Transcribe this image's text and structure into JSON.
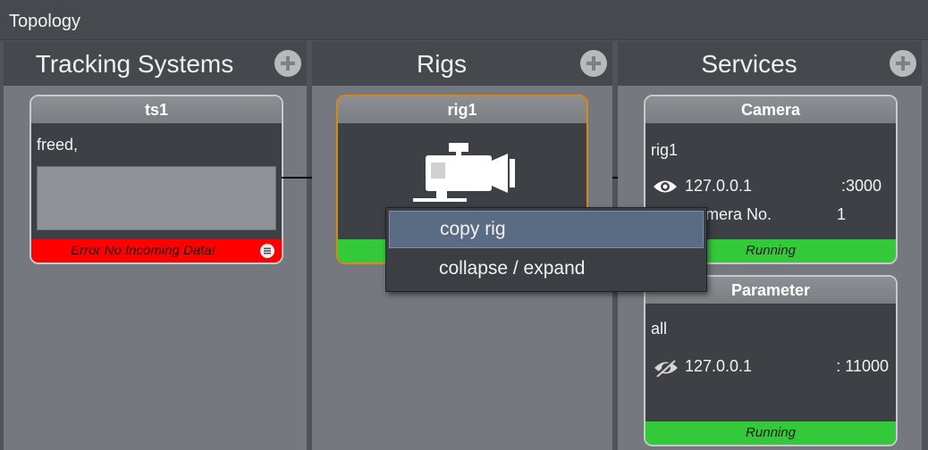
{
  "window": {
    "title": "Topology"
  },
  "columns": [
    {
      "label": "Tracking Systems"
    },
    {
      "label": "Rigs"
    },
    {
      "label": "Services"
    }
  ],
  "tracking_system": {
    "name": "ts1",
    "text": "freed,",
    "status": "Error No Incoming Data!",
    "status_color": "#ff0000"
  },
  "rig": {
    "name": "rig1",
    "icon": "camera-icon",
    "status_color": "#34c93a",
    "border_color": "#d48a1a"
  },
  "services": {
    "camera": {
      "title": "Camera",
      "rig": "rig1",
      "ip": "127.0.0.1",
      "port": ":3000",
      "camera_label": "Camera No.",
      "camera_no": "1",
      "status": "Running"
    },
    "parameter": {
      "title": "Parameter",
      "scope": "all",
      "ip": "127.0.0.1",
      "port": ": 11000",
      "status": "Running"
    }
  },
  "context_menu": {
    "items": [
      {
        "label": "copy rig",
        "selected": true
      },
      {
        "label": "collapse / expand",
        "selected": false
      }
    ]
  }
}
